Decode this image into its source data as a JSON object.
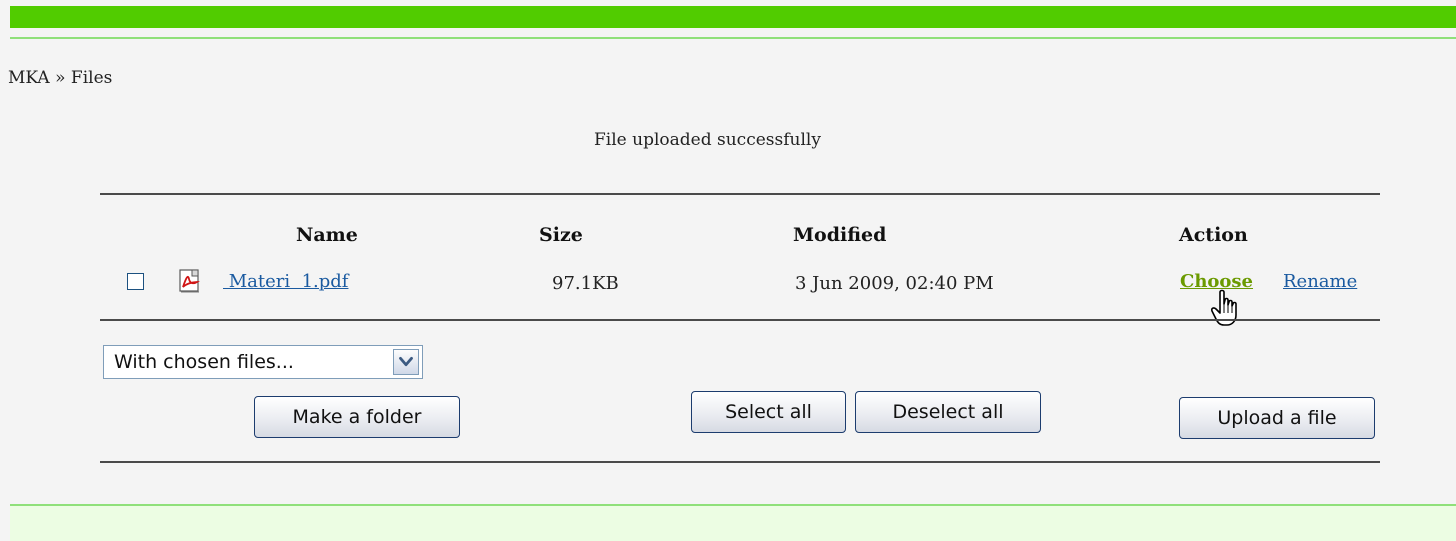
{
  "breadcrumb": "MKA » Files",
  "notice": "File uploaded successfully",
  "table": {
    "headers": {
      "name": "Name",
      "size": "Size",
      "modified": "Modified",
      "action": "Action"
    },
    "rows": [
      {
        "name": " Materi  1.pdf",
        "size": "97.1KB",
        "modified": "3 Jun 2009, 02:40 PM",
        "actions": [
          "Choose",
          "Rename"
        ],
        "icon": "pdf-icon"
      }
    ]
  },
  "controls": {
    "with_chosen": "With chosen files...",
    "make_folder": "Make a folder",
    "select_all": "Select all",
    "deselect_all": "Deselect all",
    "upload_file": "Upload a file"
  },
  "colors": {
    "top_bar": "#51cc00",
    "link": "#1a5aa0",
    "choose_link": "#6b9a00",
    "footer_band": "#ecfde3"
  }
}
